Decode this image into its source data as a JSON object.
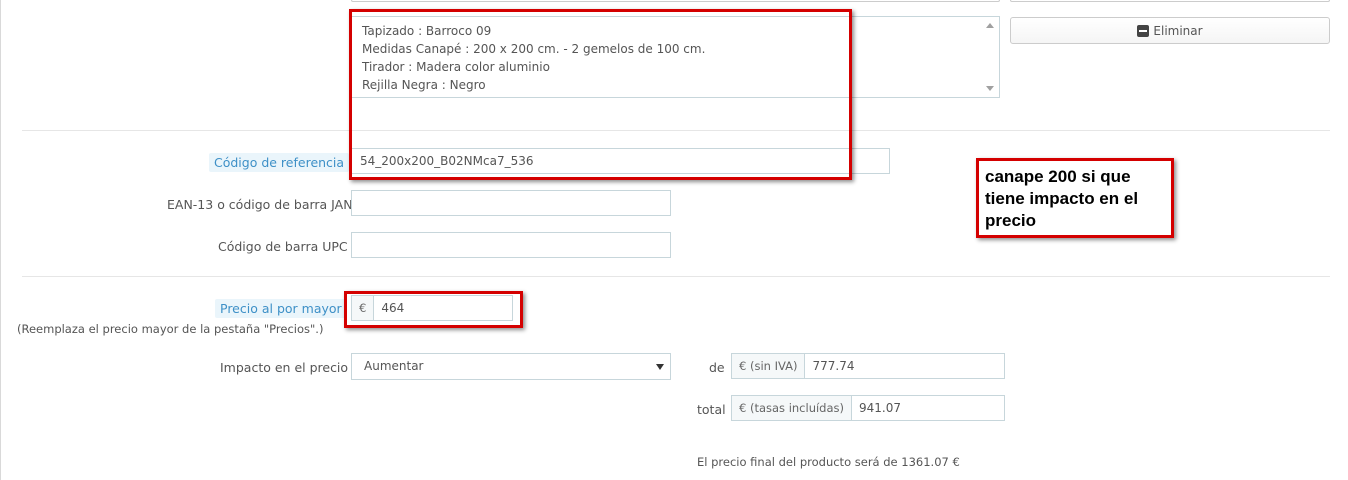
{
  "combination_list": {
    "lines": [
      "Tapizado : Barroco 09",
      "Medidas Canapé : 200 x 200 cm. - 2 gemelos de 100 cm.",
      "Tirador : Madera color aluminio",
      "Rejilla Negra : Negro"
    ]
  },
  "delete_button": {
    "label": "Eliminar"
  },
  "reference": {
    "label": "Código de referencia",
    "value": "54_200x200_B02NMca7_536"
  },
  "ean13": {
    "label": "EAN-13 o código de barra JAN",
    "value": ""
  },
  "upc": {
    "label": "Código de barra UPC",
    "value": ""
  },
  "wholesale": {
    "label": "Precio al por mayor",
    "hint": "(Reemplaza el precio mayor de la pestaña \"Precios\".)",
    "currency": "€",
    "value": "464"
  },
  "price_impact": {
    "label": "Impacto en el precio",
    "selected": "Aumentar",
    "de_label": "de",
    "tax_excl_addon": "€ (sin IVA)",
    "tax_excl_value": "777.74",
    "total_label": "total",
    "tax_incl_addon": "€ (tasas incluídas)",
    "tax_incl_value": "941.07",
    "final_price_text": "El precio final del producto será de 1361.07 €"
  },
  "annotation": {
    "text": "canape 200 si que tiene impacto en el precio"
  },
  "colors": {
    "highlight": "#d40000",
    "label_accent": "#3e90c7"
  }
}
